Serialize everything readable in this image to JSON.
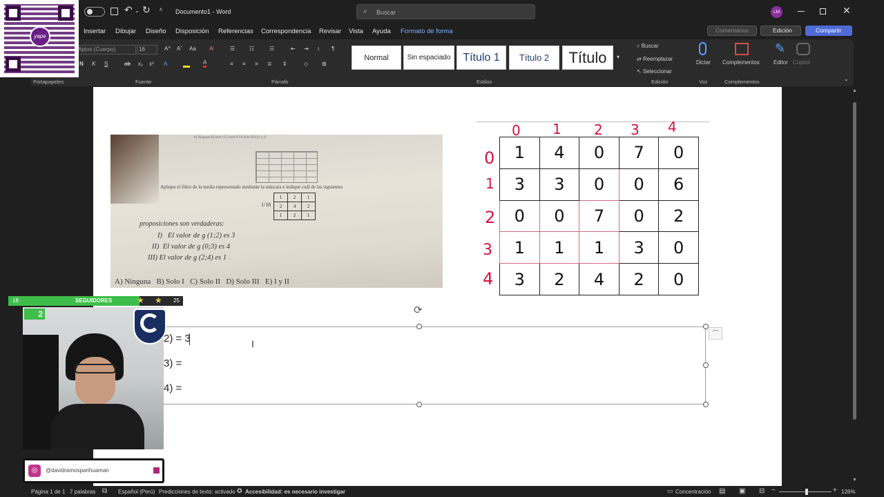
{
  "titlebar": {
    "doc_title": "Documento1",
    "app_name": "Word",
    "separator": "-",
    "search_placeholder": "Buscar",
    "user_initials": "LM"
  },
  "menu": [
    "Insertar",
    "Dibujar",
    "Diseño",
    "Disposición",
    "Referencias",
    "Correspondencia",
    "Revisar",
    "Vista",
    "Ayuda",
    "Formato de forma"
  ],
  "menu_right": {
    "comments": "Comentarios",
    "editing": "Edición",
    "share": "Compartir"
  },
  "ribbon": {
    "font_name": "Aptos (Cuerpo)",
    "font_size": "16",
    "styles": [
      "Normal",
      "Sin espaciado",
      "Título 1",
      "Título 2",
      "Título"
    ],
    "find": "Buscar",
    "replace": "Reemplazar",
    "select": "Seleccionar",
    "dictate": "Dictar",
    "addins": "Complementos",
    "editor": "Editor",
    "copilot": "Copilot",
    "group_labels": [
      "Portapapeles",
      "Fuente",
      "Párrafo",
      "Estilos",
      "Edición",
      "Voz",
      "Complementos"
    ]
  },
  "photo": {
    "options_top": "A) Ninguna   B) Solo I   C) Solo II   D) Solo III   E) I y II",
    "instruction": "Aplique el filtro de la media representado mediante la máscara e indique cuál de las siguientes",
    "mask_label": "1/16",
    "mask": [
      [
        "1",
        "2",
        "1"
      ],
      [
        "2",
        "4",
        "2"
      ],
      [
        "1",
        "2",
        "1"
      ]
    ],
    "props_heading": "proposiciones son verdaderas:",
    "props": [
      "I)   El valor de g (1;2) es 3",
      "II)  El valor de g (0;3) es 4",
      "III) El valor de g (2;4) es 1"
    ],
    "options_bottom": "A) Ninguna   B) Solo I   C) Solo II   D) Solo III   E) I y II"
  },
  "matrix": {
    "col_labels": [
      "0",
      "1",
      "2",
      "3",
      "4"
    ],
    "row_labels": [
      "0",
      "1",
      "2",
      "3",
      "4"
    ],
    "rows": [
      [
        "1",
        "4",
        "0",
        "7",
        "0"
      ],
      [
        "3",
        "3",
        "0",
        "0",
        "6"
      ],
      [
        "0",
        "0",
        "7",
        "0",
        "2"
      ],
      [
        "1",
        "1",
        "1",
        "3",
        "0"
      ],
      [
        "3",
        "2",
        "4",
        "2",
        "0"
      ]
    ]
  },
  "textbox": {
    "line1": "2) = 3",
    "line2": "3) =",
    "line3": "4) ="
  },
  "overlay": {
    "followers_left": "18",
    "followers_label": "SEGUIDORES",
    "followers_right": "25",
    "kick_badge": "2",
    "social_handle": "@davidramosparihuaman",
    "qr_caption": "yape"
  },
  "statusbar": {
    "page": "Página 1 de 1",
    "words": "7 palabras",
    "language": "Español (Perú)",
    "predictions": "Predicciones de texto: activado",
    "accessibility": "Accesibilidad: es necesario investigar",
    "focus": "Concentración",
    "zoom": "126%"
  }
}
